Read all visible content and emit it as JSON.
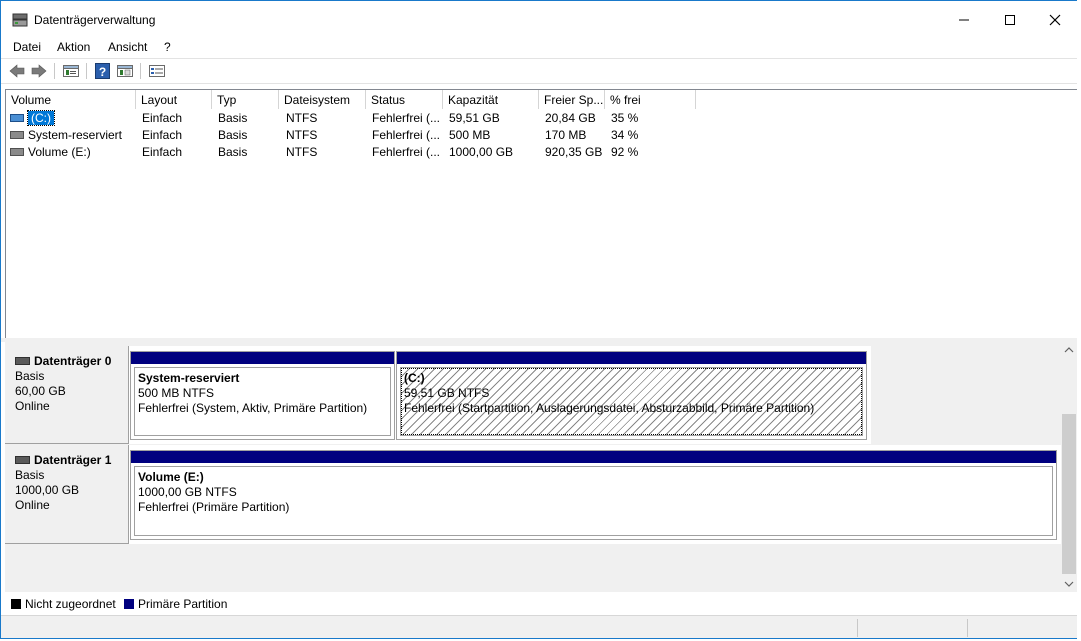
{
  "window": {
    "title": "Datenträgerverwaltung",
    "controls": {
      "minimize": "—",
      "maximize": "☐",
      "close": "✕"
    }
  },
  "menu": [
    "Datei",
    "Aktion",
    "Ansicht",
    "?"
  ],
  "toolbar": {
    "buttons": [
      "back-icon",
      "forward-icon",
      "properties-icon",
      "help-icon",
      "console-tree-icon",
      "list-view-icon"
    ]
  },
  "volume_list": {
    "columns": [
      "Volume",
      "Layout",
      "Typ",
      "Dateisystem",
      "Status",
      "Kapazität",
      "Freier Sp...",
      "% frei"
    ],
    "rows": [
      {
        "volume": "(C:)",
        "layout": "Einfach",
        "typ": "Basis",
        "dateisystem": "NTFS",
        "status": "Fehlerfrei (...",
        "kapazitaet": "59,51 GB",
        "freier": "20,84 GB",
        "prozent": "35 %"
      },
      {
        "volume": "System-reserviert",
        "layout": "Einfach",
        "typ": "Basis",
        "dateisystem": "NTFS",
        "status": "Fehlerfrei (...",
        "kapazitaet": "500 MB",
        "freier": "170 MB",
        "prozent": "34 %"
      },
      {
        "volume": "Volume (E:)",
        "layout": "Einfach",
        "typ": "Basis",
        "dateisystem": "NTFS",
        "status": "Fehlerfrei (...",
        "kapazitaet": "1000,00 GB",
        "freier": "920,35 GB",
        "prozent": "92 %"
      }
    ]
  },
  "disks": [
    {
      "name": "Datenträger 0",
      "type": "Basis",
      "size": "60,00 GB",
      "state": "Online",
      "partitions": [
        {
          "name": "System-reserviert",
          "size": "500 MB NTFS",
          "status": "Fehlerfrei (System, Aktiv, Primäre Partition)"
        },
        {
          "name": "(C:)",
          "size": "59,51 GB NTFS",
          "status": "Fehlerfrei (Startpartition, Auslagerungsdatei, Absturzabbild, Primäre Partition)"
        }
      ]
    },
    {
      "name": "Datenträger 1",
      "type": "Basis",
      "size": "1000,00 GB",
      "state": "Online",
      "partitions": [
        {
          "name": "Volume  (E:)",
          "size": "1000,00 GB NTFS",
          "status": "Fehlerfrei (Primäre Partition)"
        }
      ]
    }
  ],
  "legend": [
    {
      "label": "Nicht zugeordnet",
      "color": "#000000"
    },
    {
      "label": "Primäre Partition",
      "color": "#00007f"
    }
  ]
}
